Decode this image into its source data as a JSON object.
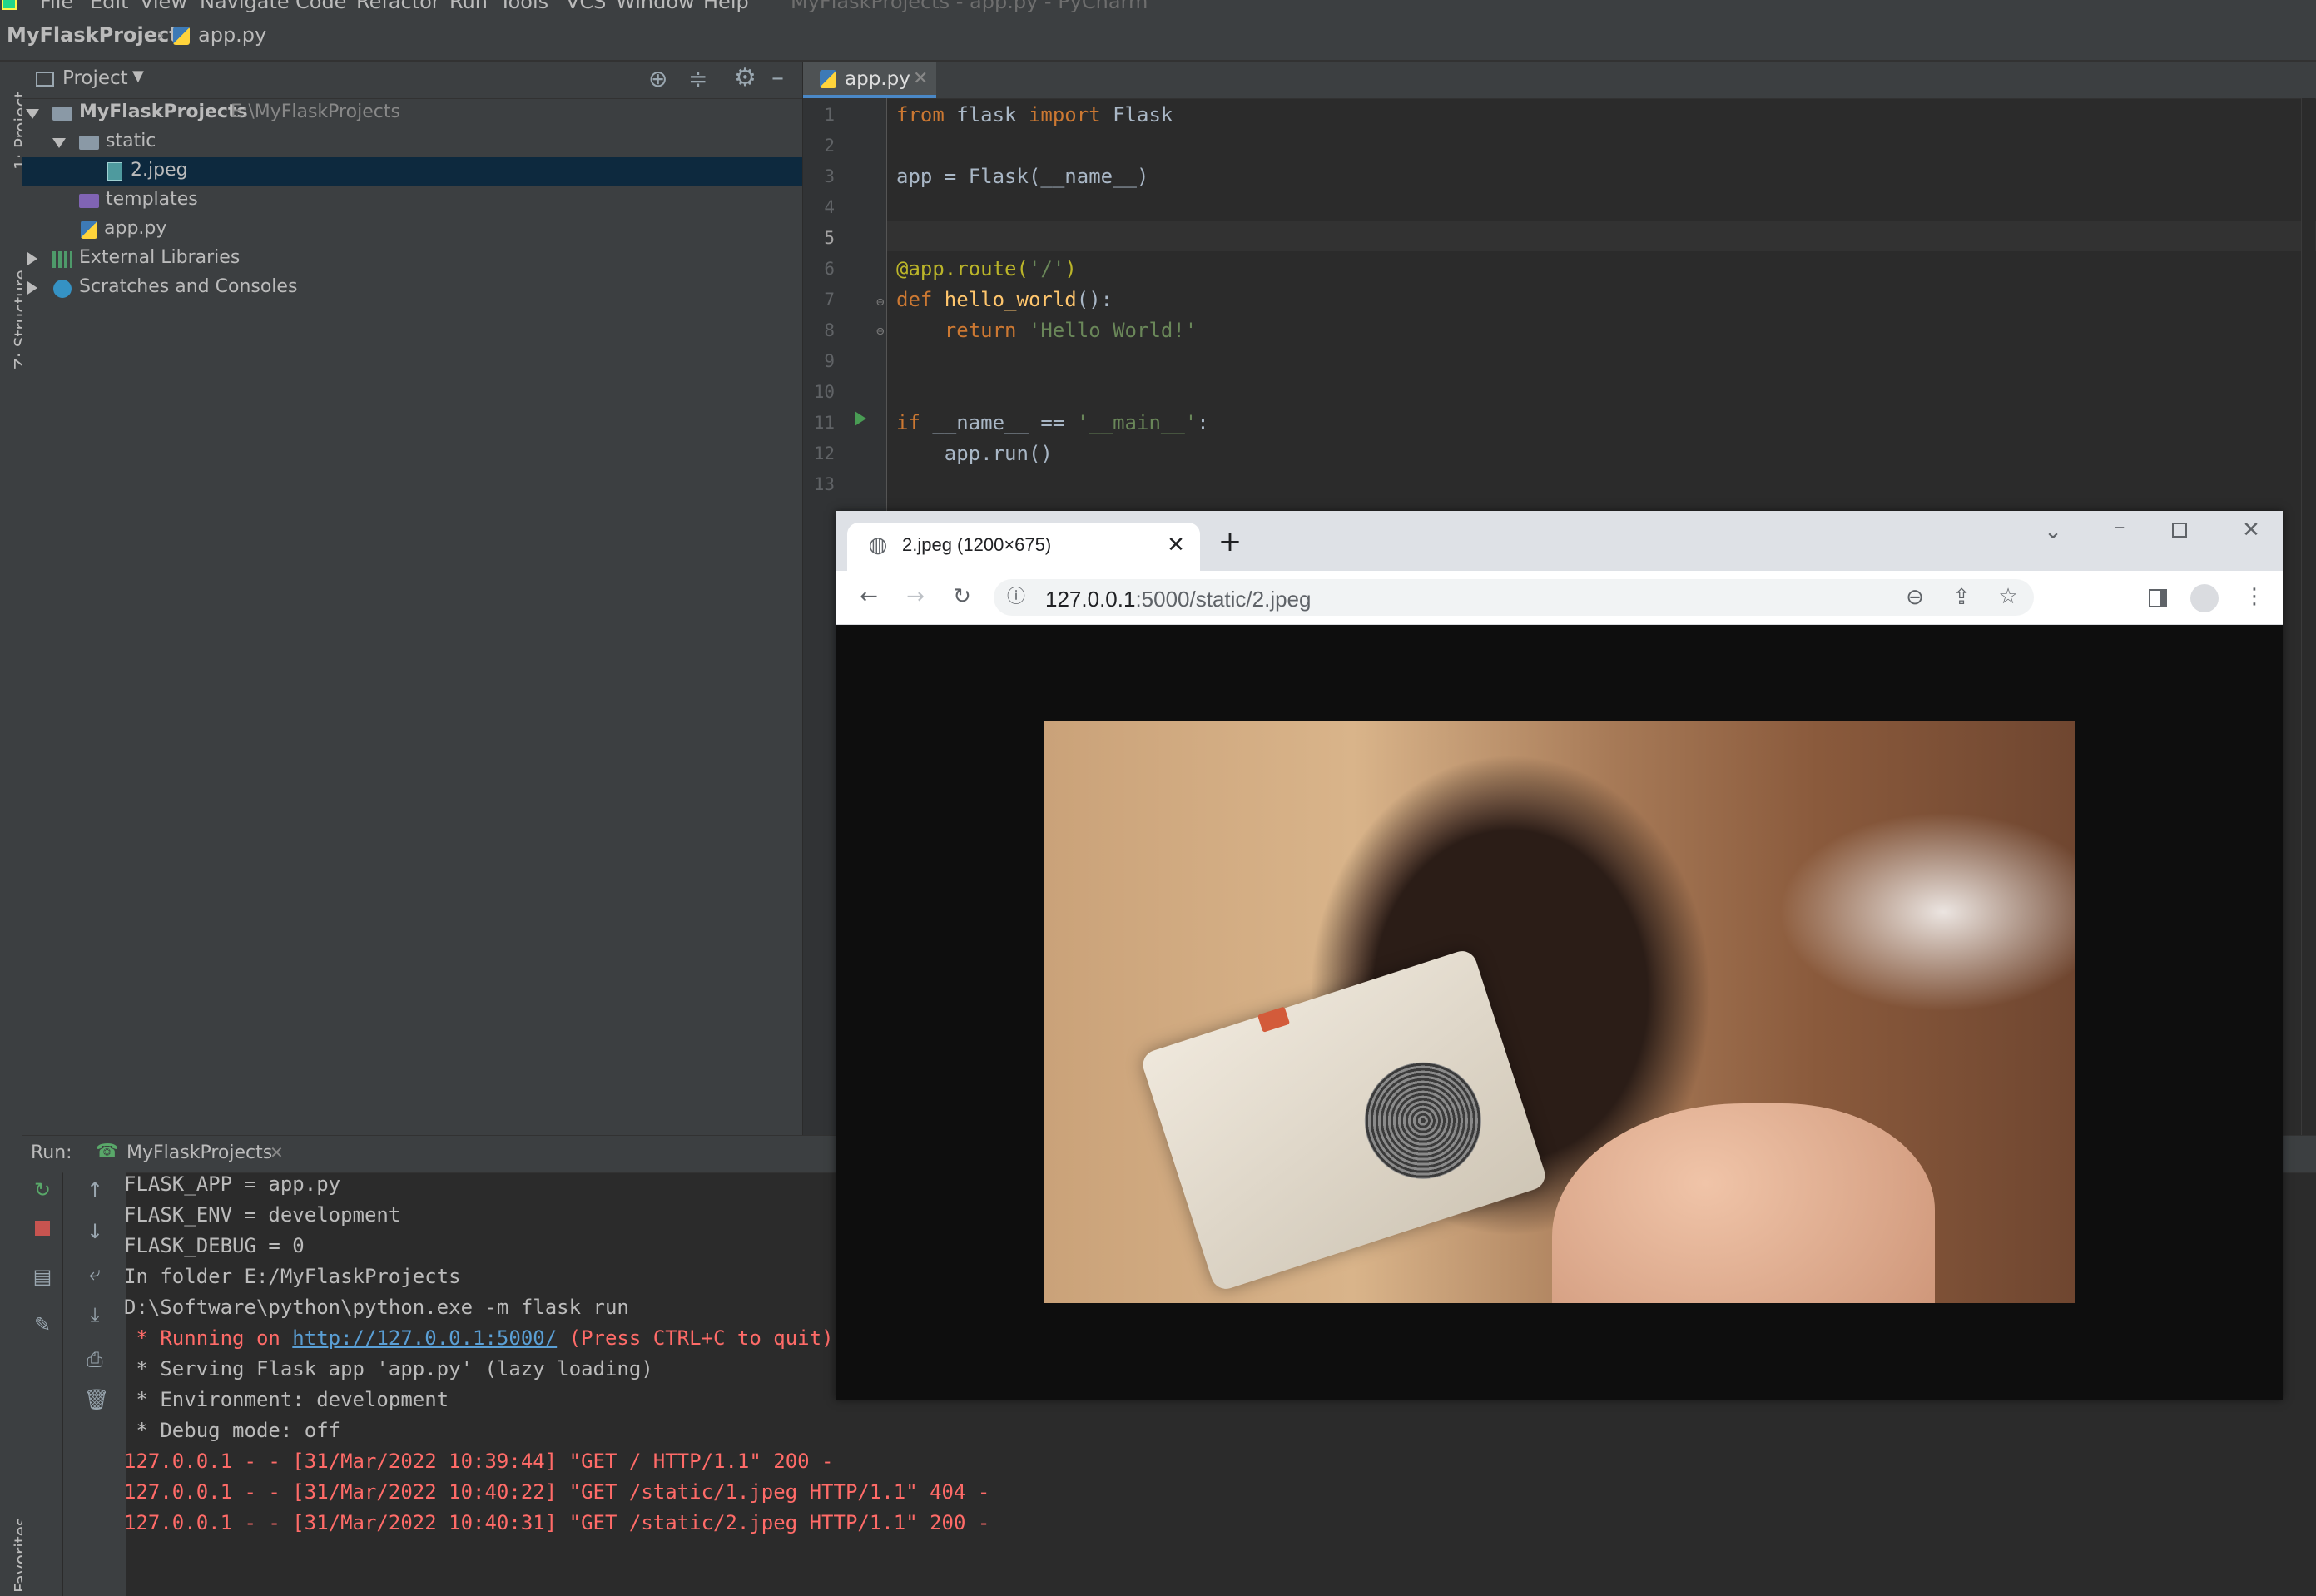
{
  "ide": {
    "menu": [
      "File",
      "Edit",
      "View",
      "Navigate",
      "Code",
      "Refactor",
      "Run",
      "Tools",
      "VCS",
      "Window",
      "Help"
    ],
    "window_title": "MyFlaskProjects - app.py - PyCharm",
    "breadcrumb": {
      "project": "MyFlaskProjects",
      "file": "app.py"
    },
    "side_tabs": {
      "project": "1: Project",
      "structure": "Z: Structure",
      "favorites": "Favorites"
    },
    "project_panel": {
      "title": "Project",
      "tree": [
        {
          "label": "MyFlaskProjects",
          "hint": "E:\\MyFlaskProjects"
        },
        {
          "label": "static"
        },
        {
          "label": "2.jpeg"
        },
        {
          "label": "templates"
        },
        {
          "label": "app.py"
        },
        {
          "label": "External Libraries"
        },
        {
          "label": "Scratches and Consoles"
        }
      ]
    },
    "editor": {
      "tab": "app.py",
      "line_numbers": [
        "1",
        "2",
        "3",
        "4",
        "5",
        "6",
        "7",
        "8",
        "9",
        "10",
        "11",
        "12",
        "13"
      ],
      "tokens": {
        "from": "from",
        "flask_mod": " flask ",
        "import": "import",
        "flask_cls": " Flask",
        "line3": "app = Flask(__name__)",
        "route": "@app.route(",
        "route_arg": "'/'",
        "route_close": ")",
        "def": "def",
        "fn": " hello_world",
        "fn_tail": "():",
        "ret": "    return",
        "ret_str": " 'Hello World!'",
        "if": "if",
        "cond": " __name__ == ",
        "main_str": "'__main__'",
        "colon": ":",
        "run": "    app.run()"
      }
    },
    "run_panel": {
      "label": "Run:",
      "config": "MyFlaskProjects",
      "console": {
        "l1": "FLASK_APP = app.py",
        "l2": "FLASK_ENV = development",
        "l3": "FLASK_DEBUG = 0",
        "l4": "In folder E:/MyFlaskProjects",
        "l5": "D:\\Software\\python\\python.exe -m flask run",
        "l6_pre": " * Running on ",
        "l6_link": "http://127.0.0.1:5000/",
        "l6_post": " (Press CTRL+C to quit)",
        "l7": " * Serving Flask app 'app.py' (lazy loading)",
        "l8": " * Environment: development",
        "l9": " * Debug mode: off",
        "l10": "127.0.0.1 - - [31/Mar/2022 10:39:44] \"GET / HTTP/1.1\" 200 -",
        "l11": "127.0.0.1 - - [31/Mar/2022 10:40:22] \"GET /static/1.jpeg HTTP/1.1\" 404 -",
        "l12": "127.0.0.1 - - [31/Mar/2022 10:40:31] \"GET /static/2.jpeg HTTP/1.1\" 200 -"
      }
    }
  },
  "browser": {
    "tab_title": "2.jpeg (1200×675)",
    "url_host": "127.0.0.1",
    "url_rest": ":5000/static/2.jpeg",
    "icons": [
      "globe-icon",
      "close-icon",
      "plus-icon",
      "chevron-down-icon",
      "minimize-icon",
      "maximize-icon",
      "close-window-icon",
      "back-icon",
      "forward-icon",
      "reload-icon",
      "info-icon",
      "zoom-out-icon",
      "share-icon",
      "star-icon",
      "side-panel-icon",
      "profile-icon",
      "menu-icon"
    ]
  },
  "colors": {
    "ide_bg": "#2b2b2b",
    "panel_bg": "#3c3f41",
    "selection": "#0d293e",
    "keyword": "#cc7832",
    "string": "#6a8759",
    "decorator": "#bbb529",
    "function": "#ffc66d",
    "console_error": "#ff6b68"
  }
}
